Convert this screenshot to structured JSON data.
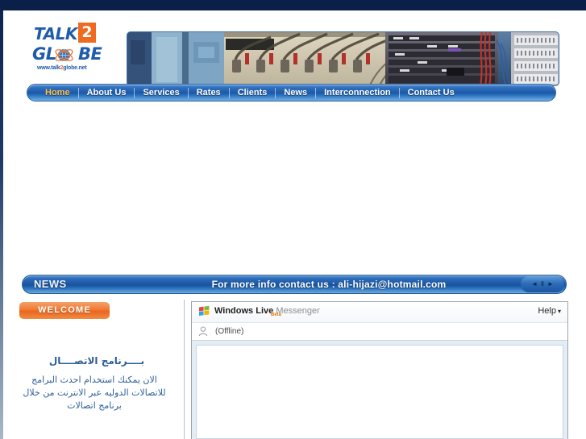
{
  "site": {
    "logo": {
      "talk": "TALK",
      "two": "2",
      "gl": "GL",
      "be": "BE",
      "url_www": "www.talk",
      "url_2": "2",
      "url_rest": "globe.net"
    },
    "banner_alt": "telecom-equipment-racks-photo"
  },
  "nav": {
    "items": [
      {
        "label": "Home",
        "active": true
      },
      {
        "label": "About Us",
        "active": false
      },
      {
        "label": "Services",
        "active": false
      },
      {
        "label": "Rates",
        "active": false
      },
      {
        "label": "Clients",
        "active": false
      },
      {
        "label": "News",
        "active": false
      },
      {
        "label": "Interconnection",
        "active": false
      },
      {
        "label": "Contact Us",
        "active": false
      }
    ]
  },
  "news": {
    "label": "NEWS",
    "message": "For more info contact us : ali-hijazi@hotmail.com",
    "controls": {
      "prev": "◄",
      "pause": "Ⅱ",
      "next": "►"
    }
  },
  "left_column": {
    "welcome_badge": "WELCOME",
    "arabic_heading": "بــــرنامج الاتصــــال",
    "arabic_body": "الان يمكنك استخدام احدث البرامج للاتصالات الدوليه عبر الانترنت من خلال برنامج اتصالات"
  },
  "messenger": {
    "brand_bold": "Windows Live",
    "brand_light": "Messenger",
    "beta": "Beta",
    "help": "Help",
    "help_caret": "▾",
    "status": "(Offline)"
  },
  "colors": {
    "top_strip": "#0b2049",
    "nav_blue": "#1d58a6",
    "nav_active": "#ffc14a",
    "logo_blue": "#1f5cab",
    "logo_orange": "#ee6b1f",
    "welcome_orange": "#e9671c",
    "arabic_text": "#2f6099"
  }
}
